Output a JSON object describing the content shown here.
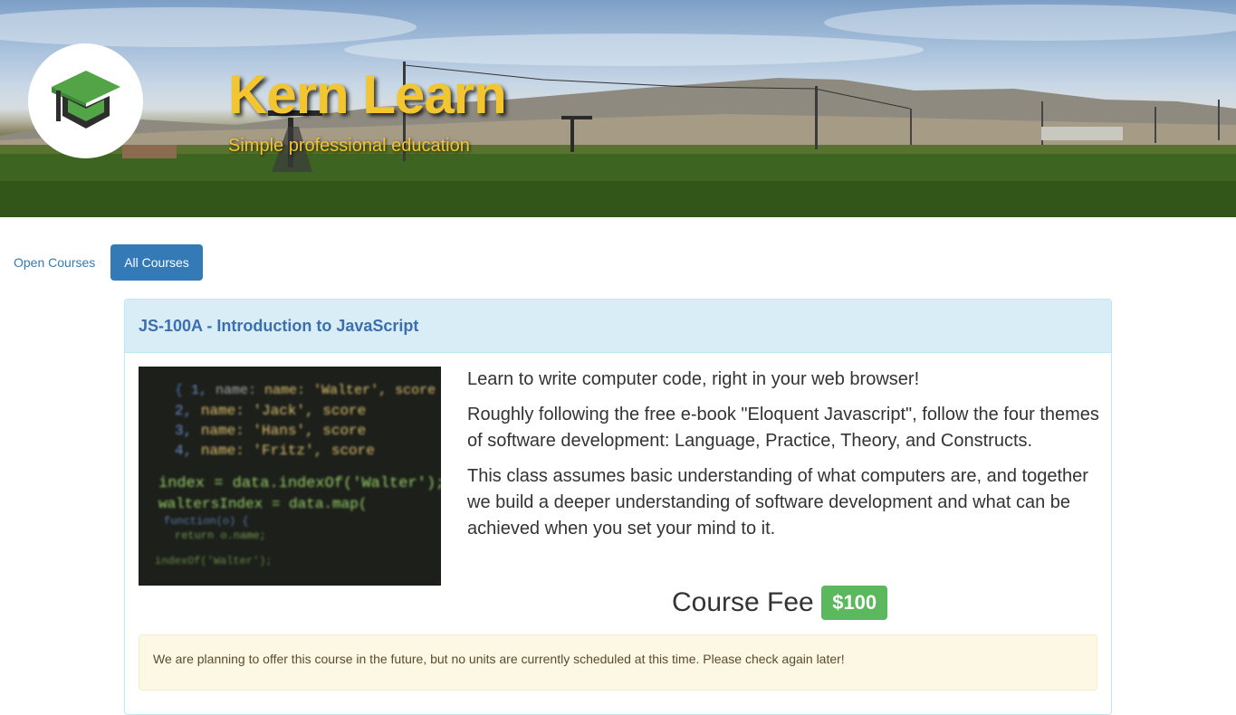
{
  "site": {
    "title": "Kern Learn",
    "subtitle": "Simple professional education",
    "brand_color": "#f3c52e"
  },
  "nav": {
    "open_courses": "Open Courses",
    "all_courses": "All Courses",
    "active": "All Courses"
  },
  "course": {
    "title": "JS-100A - Introduction to JavaScript",
    "paragraphs": [
      "Learn to write computer code, right in your web browser!",
      "Roughly following the free e-book \"Eloquent Javascript\", follow the four themes of software development: Language, Practice, Theory, and Constructs.",
      "This class assumes basic understanding of what computers are, and together we build a deeper understanding of software development and what can be achieved when you set your mind to it."
    ],
    "fee_label": "Course Fee",
    "fee_value": "$100",
    "notice": "We are planning to offer this course in the future, but no units are currently scheduled at this time. Please check again later!",
    "image_code": [
      "name: 'Walter', score",
      "name: 'Jack', score",
      "name: 'Hans', score",
      "name: 'Fritz', score",
      "index = data.indexOf('Walter');",
      "waltersIndex = data.map(",
      "function(o) {",
      "return o.name;",
      "indexOf('Walter');"
    ]
  },
  "colors": {
    "primary": "#337ab7",
    "panel_heading": "#d9edf7",
    "success": "#5cb85c",
    "warning_bg": "#fcf8e3"
  }
}
